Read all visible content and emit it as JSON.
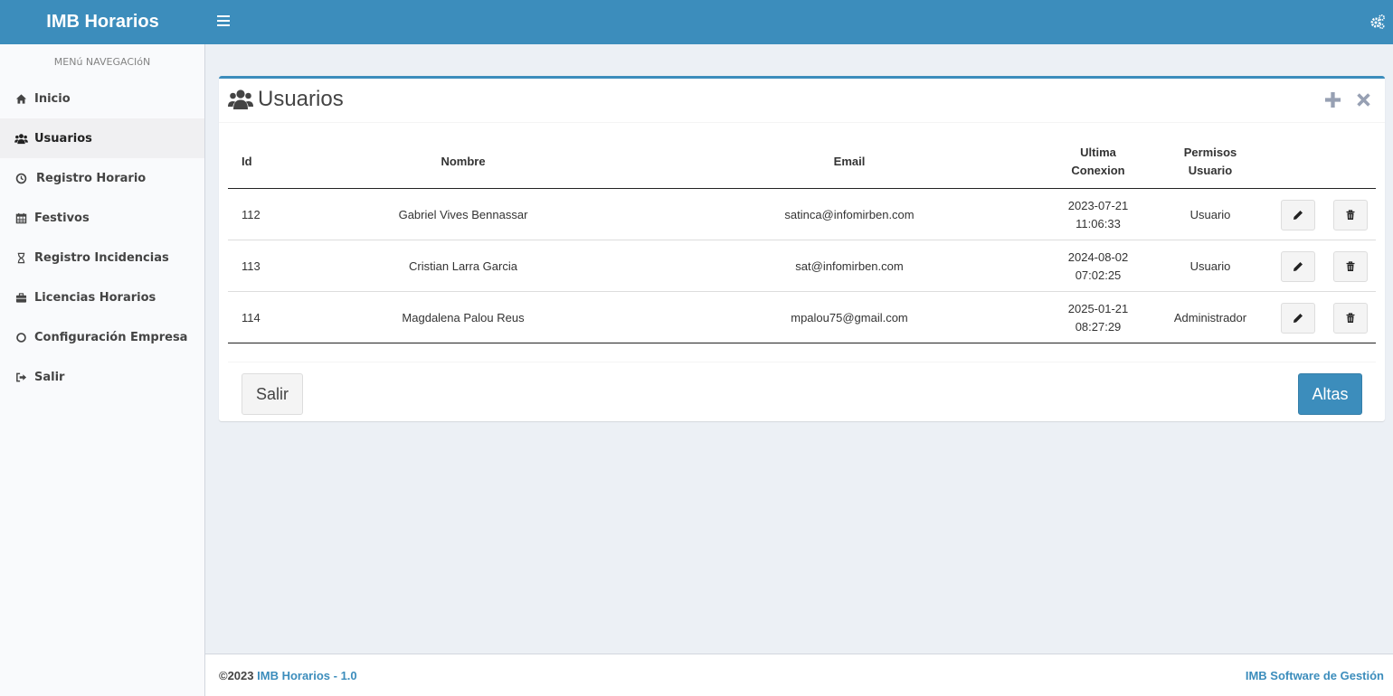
{
  "app": {
    "brand": "IMB Horarios"
  },
  "sidebar": {
    "header": "MENú NAVEGACIóN",
    "items": [
      {
        "label": "Inicio",
        "icon": "home-icon"
      },
      {
        "label": "Usuarios",
        "icon": "users-icon",
        "active": true
      },
      {
        "label": "Registro Horario",
        "icon": "clock-icon"
      },
      {
        "label": "Festivos",
        "icon": "calendar-icon"
      },
      {
        "label": "Registro Incidencias",
        "icon": "hourglass-icon"
      },
      {
        "label": "Licencias Horarios",
        "icon": "briefcase-icon"
      },
      {
        "label": "Configuración Empresa",
        "icon": "circle-icon"
      },
      {
        "label": "Salir",
        "icon": "sign-out-icon"
      }
    ]
  },
  "box": {
    "title": "Usuarios"
  },
  "table": {
    "headers": {
      "id": "Id",
      "nombre": "Nombre",
      "email": "Email",
      "ultima_1": "Ultima",
      "ultima_2": "Conexion",
      "permisos_1": "Permisos",
      "permisos_2": "Usuario"
    },
    "rows": [
      {
        "id": "112",
        "nombre": "Gabriel Vives Bennassar",
        "email": "satinca@infomirben.com",
        "date": "2023-07-21",
        "time": "11:06:33",
        "permiso": "Usuario"
      },
      {
        "id": "113",
        "nombre": "Cristian Larra Garcia",
        "email": "sat@infomirben.com",
        "date": "2024-08-02",
        "time": "07:02:25",
        "permiso": "Usuario"
      },
      {
        "id": "114",
        "nombre": "Magdalena Palou Reus",
        "email": "mpalou75@gmail.com",
        "date": "2025-01-21",
        "time": "08:27:29",
        "permiso": "Administrador"
      }
    ]
  },
  "buttons": {
    "salir": "Salir",
    "altas": "Altas"
  },
  "footer": {
    "copyright": "©2023",
    "app_link": "IMB Horarios - 1.0",
    "company": "IMB Software de Gestión"
  },
  "colors": {
    "primary": "#3c8dbc",
    "background": "#ecf0f5",
    "sidebar": "#f9fafc"
  }
}
